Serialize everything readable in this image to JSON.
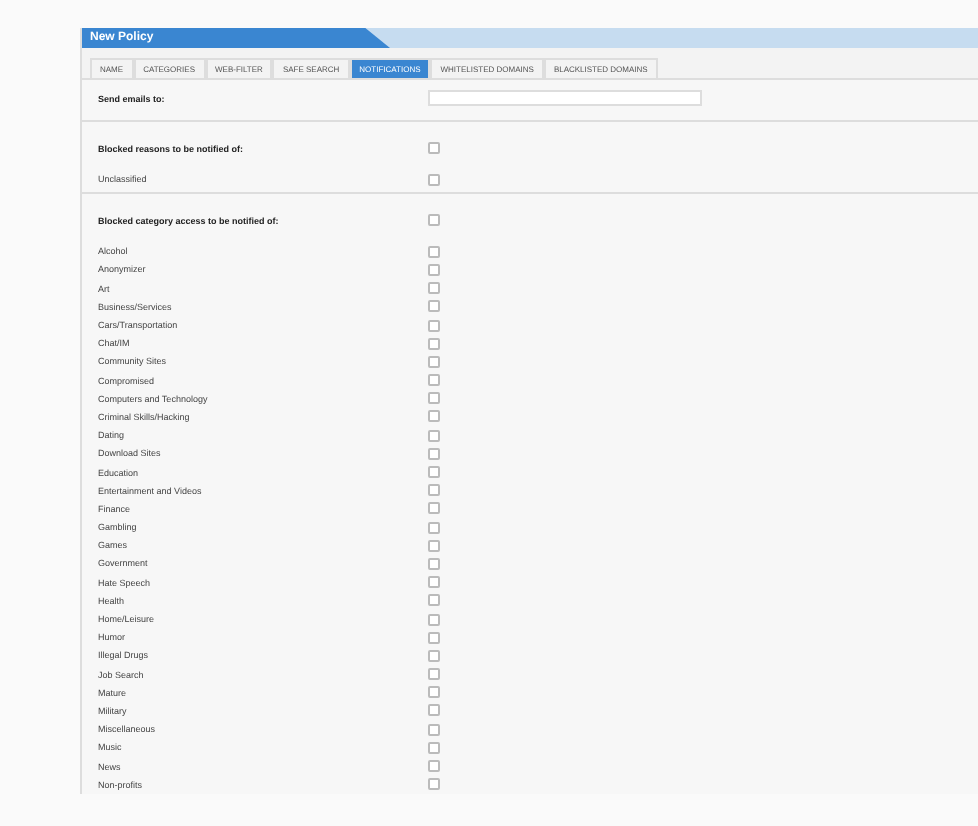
{
  "window": {
    "title": "New Policy"
  },
  "tabs": [
    {
      "label": "NAME",
      "selected": false
    },
    {
      "label": "CATEGORIES",
      "selected": false
    },
    {
      "label": "WEB-FILTER",
      "selected": false
    },
    {
      "label": "SAFE SEARCH",
      "selected": false
    },
    {
      "label": "NOTIFICATIONS",
      "selected": true
    },
    {
      "label": "WHITELISTED DOMAINS",
      "selected": false
    },
    {
      "label": "BLACKLISTED DOMAINS",
      "selected": false
    }
  ],
  "email": {
    "label": "Send emails to:"
  },
  "sections": [
    {
      "label": "Blocked reasons to be notified of:",
      "checked": false,
      "items": [
        {
          "label": "Unclassified",
          "checked": false
        }
      ]
    },
    {
      "label": "Blocked category access to be notified of:",
      "checked": false,
      "items": [
        {
          "label": "Alcohol",
          "checked": false
        },
        {
          "label": "Anonymizer",
          "checked": false
        },
        {
          "label": "Art",
          "checked": false
        },
        {
          "label": "Business/Services",
          "checked": false
        },
        {
          "label": "Cars/Transportation",
          "checked": false
        },
        {
          "label": "Chat/IM",
          "checked": false
        },
        {
          "label": "Community Sites",
          "checked": false
        },
        {
          "label": "Compromised",
          "checked": false
        },
        {
          "label": "Computers and Technology",
          "checked": false
        },
        {
          "label": "Criminal Skills/Hacking",
          "checked": false
        },
        {
          "label": "Dating",
          "checked": false
        },
        {
          "label": "Download Sites",
          "checked": false
        },
        {
          "label": "Education",
          "checked": false
        },
        {
          "label": "Entertainment and Videos",
          "checked": false
        },
        {
          "label": "Finance",
          "checked": false
        },
        {
          "label": "Gambling",
          "checked": false
        },
        {
          "label": "Games",
          "checked": false
        },
        {
          "label": "Government",
          "checked": false
        },
        {
          "label": "Hate Speech",
          "checked": false
        },
        {
          "label": "Health",
          "checked": false
        },
        {
          "label": "Home/Leisure",
          "checked": false
        },
        {
          "label": "Humor",
          "checked": false
        },
        {
          "label": "Illegal Drugs",
          "checked": false
        },
        {
          "label": "Job Search",
          "checked": false
        },
        {
          "label": "Mature",
          "checked": false
        },
        {
          "label": "Military",
          "checked": false
        },
        {
          "label": "Miscellaneous",
          "checked": false
        },
        {
          "label": "Music",
          "checked": false
        },
        {
          "label": "News",
          "checked": false
        },
        {
          "label": "Non-profits",
          "checked": false
        }
      ]
    }
  ]
}
